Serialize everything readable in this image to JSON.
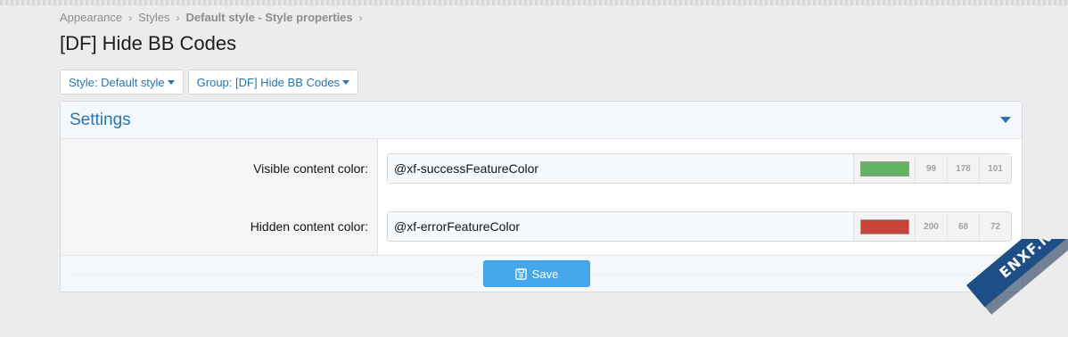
{
  "breadcrumb": [
    {
      "label": "Appearance",
      "bold": false
    },
    {
      "label": "Styles",
      "bold": false
    },
    {
      "label": "Default style - Style properties",
      "bold": true
    }
  ],
  "page": {
    "title": "[DF] Hide BB Codes"
  },
  "filters": {
    "style_label": "Style: Default style",
    "group_label": "Group: [DF] Hide BB Codes"
  },
  "panel": {
    "title": "Settings",
    "save_label": "Save"
  },
  "rows": [
    {
      "label": "Visible content color:",
      "value": "@xf-successFeatureColor",
      "swatch": "#63b363",
      "r": "99",
      "g": "178",
      "b": "101"
    },
    {
      "label": "Hidden content color:",
      "value": "@xf-errorFeatureColor",
      "swatch": "#c84438",
      "r": "200",
      "g": "68",
      "b": "72"
    }
  ],
  "watermark": {
    "text": "ENXF.NET"
  },
  "colors": {
    "accent": "#2577b1",
    "save_button": "#47a7eb",
    "header_bg": "#f4f8fc"
  }
}
